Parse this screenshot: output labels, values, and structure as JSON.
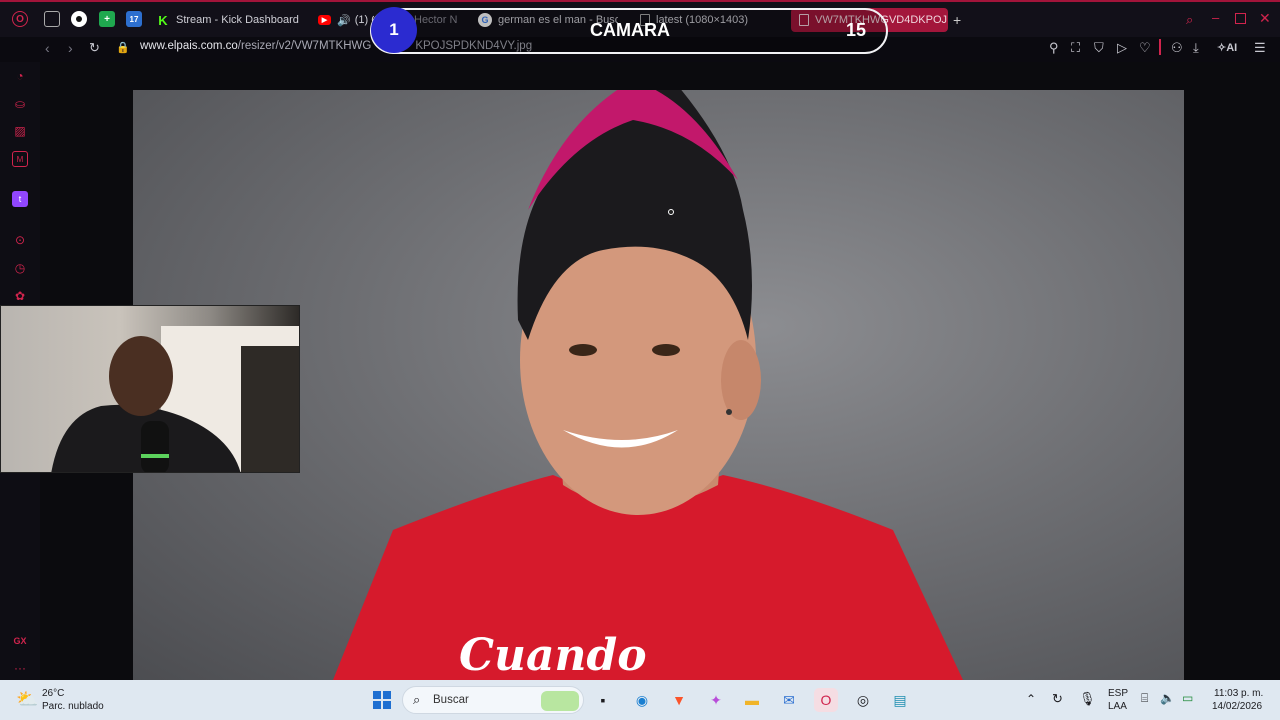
{
  "tabs": {
    "pinned": [
      {
        "name": "opera-logo-icon"
      },
      {
        "name": "media-icon"
      },
      {
        "name": "circle-app-icon"
      },
      {
        "name": "plus-app-icon"
      },
      {
        "name": "app-17-icon",
        "text": "17"
      }
    ],
    "items": [
      {
        "label": "Stream - Kick Dashboard",
        "icon": "K"
      },
      {
        "label": "(1) C",
        "icon": "▶"
      },
      {
        "label": "Hector N",
        "icon": ""
      },
      {
        "label": "german es el man - Busca",
        "icon": "G"
      },
      {
        "label": "latest (1080×1403)",
        "icon": ""
      },
      {
        "label": "VW7MTKHWGVD4DKPOJ",
        "icon": ""
      }
    ],
    "new_tab": "+"
  },
  "address": {
    "host": "www.elpais.com.co",
    "path": "/resizer/v2/VW7MTKHWG",
    "path_end": "KPOJSPDKND4VY.jpg"
  },
  "toolbar": {
    "ai_label": "AI"
  },
  "overlay": {
    "left_count": "1",
    "label": "CAMARA",
    "right_count": "15"
  },
  "shirt_text": "Cuando",
  "taskbar": {
    "temp": "26°C",
    "weather": "Parc. nublado",
    "search_placeholder": "Buscar",
    "lang_top": "ESP",
    "lang_bottom": "LAA",
    "time": "11:03 p. m.",
    "date": "14/02/2026"
  },
  "sidebar": {
    "gx_label": "GX",
    "more_label": "···"
  },
  "colors": {
    "accent": "#d0244d",
    "badge_blue": "#2b2bd0",
    "shirt_red": "#d61a2c"
  }
}
